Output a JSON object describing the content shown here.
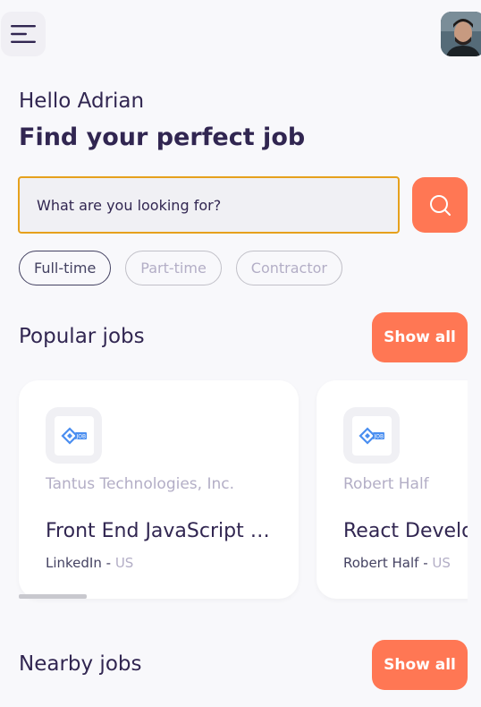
{
  "header": {
    "menu_icon": "hamburger-menu-icon",
    "avatar_icon": "user-avatar"
  },
  "welcome": {
    "greeting": "Hello Adrian",
    "headline": "Find your perfect job"
  },
  "search": {
    "placeholder": "What are you looking for?",
    "value": "",
    "button_icon": "search-icon"
  },
  "job_types": [
    {
      "label": "Full-time",
      "active": true
    },
    {
      "label": "Part-time",
      "active": false
    },
    {
      "label": "Contractor",
      "active": false
    }
  ],
  "popular": {
    "title": "Popular jobs",
    "show_all": "Show all",
    "jobs": [
      {
        "company": "Tantus Technologies, Inc.",
        "title": "Front End JavaScript Developer",
        "publisher": "LinkedIn",
        "separator": " - ",
        "country": "US"
      },
      {
        "company": "Robert Half",
        "title": "React Developer",
        "publisher": "Robert Half",
        "separator": " - ",
        "country": "US"
      }
    ]
  },
  "nearby": {
    "title": "Nearby jobs",
    "show_all": "Show all"
  },
  "colors": {
    "accent": "#FF7754",
    "primary": "#312651",
    "gray": "#B3AEC6",
    "search_border": "#E6A11D"
  }
}
